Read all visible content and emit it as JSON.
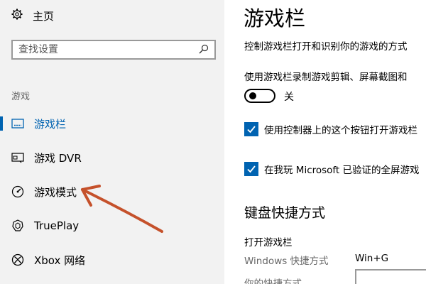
{
  "sidebar": {
    "home_label": "主页",
    "search_placeholder": "查找设置",
    "section_label": "游戏",
    "items": [
      {
        "label": "游戏栏",
        "icon": "game-bar-icon"
      },
      {
        "label": "游戏 DVR",
        "icon": "dvr-icon"
      },
      {
        "label": "游戏模式",
        "icon": "game-mode-icon"
      },
      {
        "label": "TruePlay",
        "icon": "trueplay-icon"
      },
      {
        "label": "Xbox 网络",
        "icon": "xbox-icon"
      }
    ]
  },
  "main": {
    "title": "游戏栏",
    "description": "控制游戏栏打开和识别你的游戏的方式",
    "record_label": "使用游戏栏录制游戏剪辑、屏幕截图和",
    "toggle_state": "关",
    "checkbox1_label": "使用控制器上的这个按钮打开游戏栏",
    "checkbox2_label": "在我玩 Microsoft 已验证的全屏游戏",
    "shortcuts_title": "键盘快捷方式",
    "open_game_bar_label": "打开游戏栏",
    "windows_shortcut_label": "Windows 快捷方式",
    "windows_shortcut_value": "Win+G",
    "your_shortcut_label": "你的快捷方式"
  },
  "colors": {
    "accent": "#0063b1",
    "annotation_arrow": "#c5512b"
  }
}
